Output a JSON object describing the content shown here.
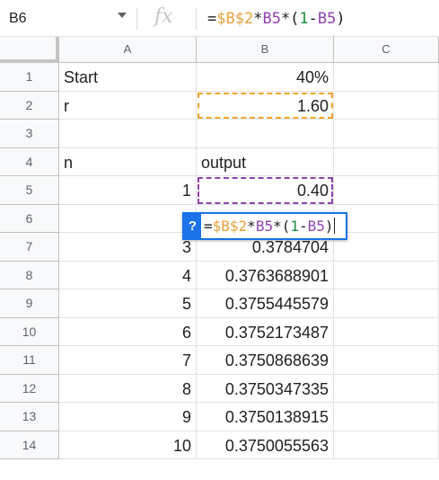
{
  "name_box": "B6",
  "fx_icon": "fx-icon",
  "formula_parts": [
    {
      "text": "=",
      "kind": "op"
    },
    {
      "text": "$B$2",
      "kind": "ref1"
    },
    {
      "text": "*",
      "kind": "op"
    },
    {
      "text": "B5",
      "kind": "ref2"
    },
    {
      "text": "*(",
      "kind": "op"
    },
    {
      "text": "1",
      "kind": "num"
    },
    {
      "text": "-",
      "kind": "op"
    },
    {
      "text": "B5",
      "kind": "ref2"
    },
    {
      "text": ")",
      "kind": "op"
    }
  ],
  "columns": [
    "A",
    "B",
    "C"
  ],
  "rows": [
    {
      "num": "1",
      "a": "Start",
      "a_align": "left",
      "b": "40%"
    },
    {
      "num": "2",
      "a": "r",
      "a_align": "left",
      "b": "1.60"
    },
    {
      "num": "3",
      "a": "",
      "a_align": "left",
      "b": ""
    },
    {
      "num": "4",
      "a": "n",
      "a_align": "left",
      "b": "output",
      "b_align": "left"
    },
    {
      "num": "5",
      "a": "1",
      "a_align": "right",
      "b": "0.40"
    },
    {
      "num": "6",
      "a": "",
      "a_align": "right",
      "b": ""
    },
    {
      "num": "7",
      "a": "3",
      "a_align": "right",
      "b": "0.3784704"
    },
    {
      "num": "8",
      "a": "4",
      "a_align": "right",
      "b": "0.3763688901"
    },
    {
      "num": "9",
      "a": "5",
      "a_align": "right",
      "b": "0.3755445579"
    },
    {
      "num": "10",
      "a": "6",
      "a_align": "right",
      "b": "0.3752173487"
    },
    {
      "num": "11",
      "a": "7",
      "a_align": "right",
      "b": "0.3750868639"
    },
    {
      "num": "12",
      "a": "8",
      "a_align": "right",
      "b": "0.3750347335"
    },
    {
      "num": "13",
      "a": "9",
      "a_align": "right",
      "b": "0.3750138915"
    },
    {
      "num": "14",
      "a": "10",
      "a_align": "right",
      "b": "0.3750055563"
    }
  ],
  "edit_help": "?",
  "colors": {
    "ref1": "#e8a13a",
    "ref2": "#8e44ad",
    "num": "#1a8f40",
    "selection": "#1a73e8"
  }
}
